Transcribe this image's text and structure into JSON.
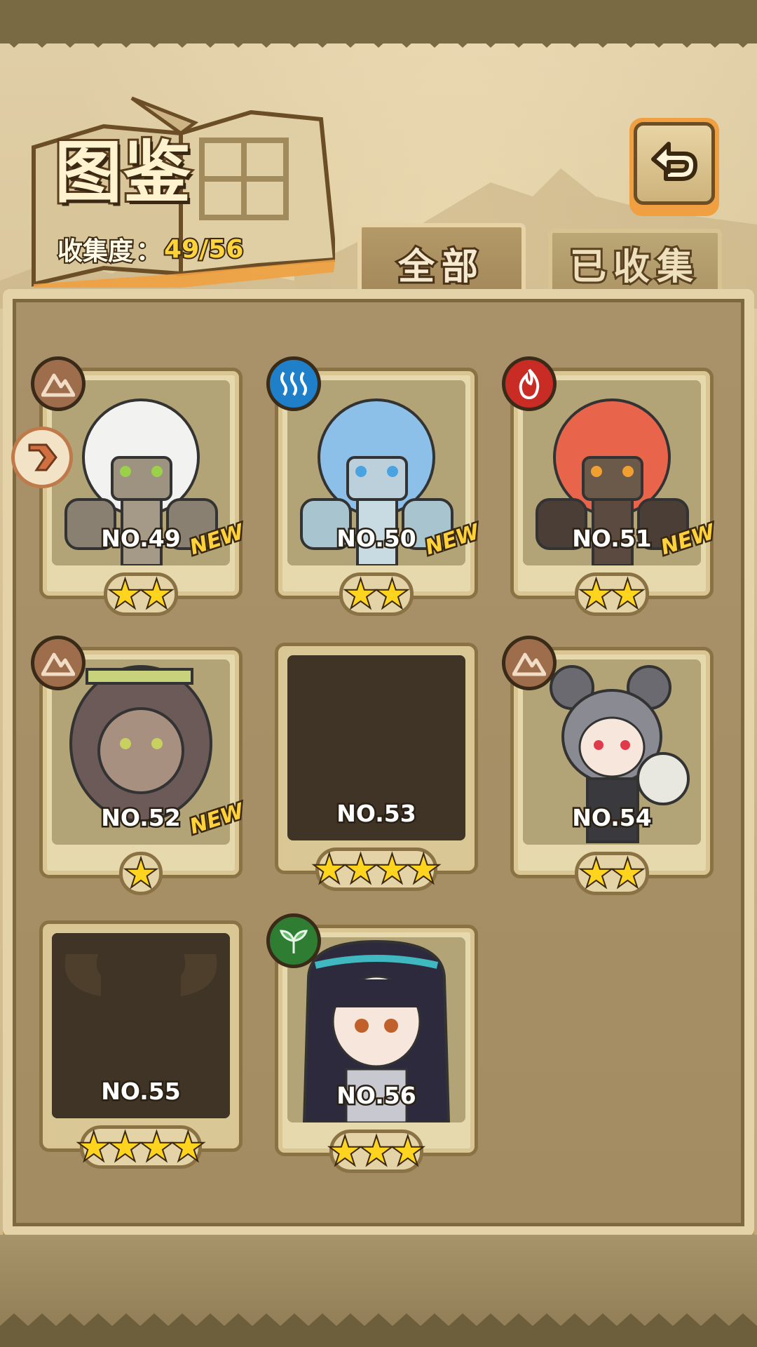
{
  "header": {
    "title": "图鉴",
    "collection_label": "收集度",
    "collection_colon": "：",
    "collection_value": "49/56"
  },
  "tabs": [
    {
      "label": "全部",
      "active": true
    },
    {
      "label": "已收集",
      "active": false
    }
  ],
  "cards": [
    {
      "number": "NO.49",
      "stars": "★★",
      "new": "NEW",
      "element": "earth-icon",
      "locked": false
    },
    {
      "number": "NO.50",
      "stars": "★★",
      "new": "NEW",
      "element": "water-icon",
      "locked": false
    },
    {
      "number": "NO.51",
      "stars": "★★",
      "new": "NEW",
      "element": "fire-icon",
      "locked": false
    },
    {
      "number": "NO.52",
      "stars": "★",
      "new": "NEW",
      "element": "earth-icon",
      "locked": false
    },
    {
      "number": "NO.53",
      "stars": "★★★★",
      "locked": true
    },
    {
      "number": "NO.54",
      "stars": "★★",
      "element": "earth-icon",
      "locked": false
    },
    {
      "number": "NO.55",
      "stars": "★★★★",
      "locked": true
    },
    {
      "number": "NO.56",
      "stars": "★★★",
      "element": "leaf-icon",
      "locked": false
    }
  ],
  "colors": {
    "accent_orange": "#f0a040",
    "star_yellow": "#ffd41f",
    "collection_value": "#ffd43a",
    "panel": "#a9916a"
  }
}
